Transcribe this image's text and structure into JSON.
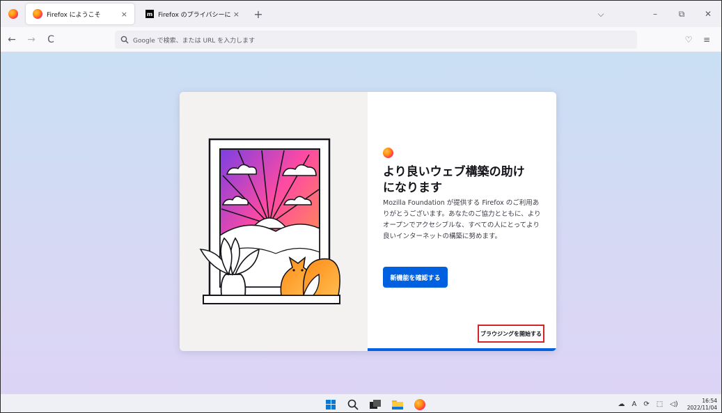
{
  "tabs": [
    {
      "title": "Firefox にようこそ",
      "icon": "firefox-logo",
      "active": true
    },
    {
      "title": "Firefox のプライバシーに関する通知",
      "icon": "mozilla-m-logo",
      "active": false
    }
  ],
  "tab_close": "×",
  "new_tab": "+",
  "icon_glyphs": {
    "m": "m",
    "back": "←",
    "forward": "→",
    "reload": "C",
    "tab_list": "⌵",
    "minimize": "–",
    "restore": "⧉",
    "close": "✕",
    "pocket": "♡",
    "menu": "≡",
    "search": "⌕",
    "cloud": "☁",
    "ime": "A",
    "sync": "⟳",
    "display": "⬚",
    "volume": "◁)"
  },
  "urlbar": {
    "placeholder": "Google で検索、または URL を入力します"
  },
  "card": {
    "headline_line1": "より良いウェブ構築の助け",
    "headline_line2": "になります",
    "body": "Mozilla Foundation が提供する Firefox のご利用ありがとうございます。あなたのご協力とともに、よりオープンでアクセシブルな、すべての人にとってより良いインターネットの構築に努めます。",
    "primary_button": "新機能を確認する",
    "secondary_button": "ブラウジングを開始する",
    "progress_percent": 100
  },
  "taskbar": {
    "time": "16:54",
    "date": "2022/11/04"
  },
  "colors": {
    "accent": "#0061e0",
    "highlight": "#d2232a"
  }
}
